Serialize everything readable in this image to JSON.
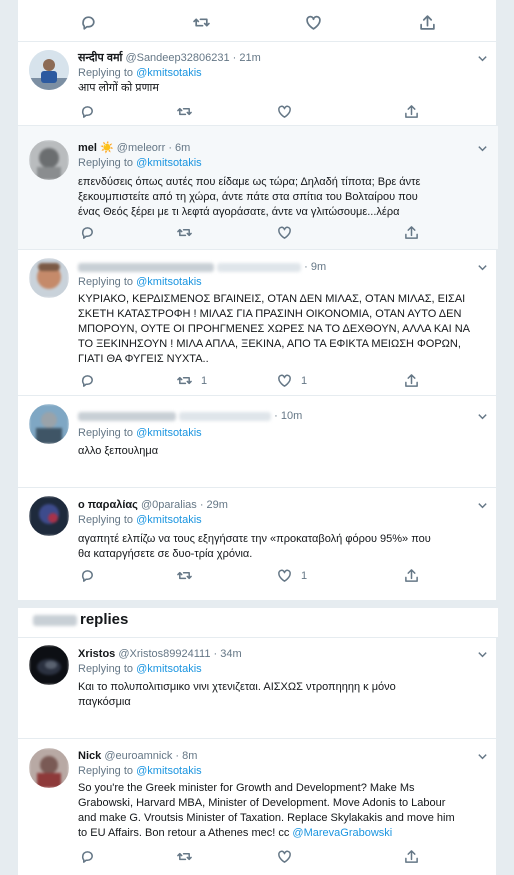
{
  "top_actions": {
    "icons": [
      "reply-icon",
      "retweet-icon",
      "like-icon",
      "share-icon"
    ]
  },
  "tweets": [
    {
      "name": "सन्दीप वर्मा",
      "handle": "@Sandeep32806231",
      "time": "· 21m",
      "replying_prefix": "Replying to",
      "replying_to": "@kmitsotakis",
      "text_lines": [
        "आप लोगों को प्रणाम"
      ],
      "reply_count": "",
      "retweet_count": "",
      "like_count": ""
    },
    {
      "name": "mel",
      "name_emoji": "☀️",
      "handle": "@meleorr",
      "time": "· 6m",
      "replying_prefix": "Replying to",
      "replying_to": "@kmitsotakis",
      "text_lines": [
        "επενδύσεις όπως αυτές που είδαμε ως τώρα; Δηλαδή τίποτα; Βρε άντε",
        "ξεκουμπιστείτε από τη χώρα, άντε πάτε στα σπίτια του Βολταίρου που",
        "ένας Θεός ξέρει με τι λεφτά αγοράσατε, άντε να γλιτώσουμε...λέρα"
      ],
      "reply_count": "",
      "retweet_count": "",
      "like_count": ""
    },
    {
      "name": "",
      "handle": "",
      "time": "· 9m",
      "replying_prefix": "Replying to",
      "replying_to": "@kmitsotakis",
      "text_lines": [
        "ΚΥΡΙΑΚΟ, ΚΕΡΔΙΣΜΕΝΟΣ ΒΓΑΙΝΕΙΣ, ΟΤΑΝ ΔΕΝ ΜΙΛΑΣ, ΟΤΑΝ ΜΙΛΑΣ, ΕΙΣΑΙ",
        "ΣΚΕΤΗ ΚΑΤΑΣΤΡΟΦΗ ! ΜΙΛΑΣ ΓΙΑ ΠΡΑΣΙΝΗ ΟΙΚΟΝΟΜΙΑ, ΟΤΑΝ ΑΥΤΟ ΔΕΝ",
        "ΜΠΟΡΟΥΝ, ΟΥΤΕ ΟΙ ΠΡΟΗΓΜΕΝΕΣ ΧΩΡΕΣ ΝΑ ΤΟ ΔΕΧΘΟΥΝ, ΑΛΛΑ ΚΑΙ ΝΑ",
        "ΤΟ ΞΕΚΙΝΗΣΟΥΝ ! ΜΙΛΑ ΑΠΛΑ, ΞΕΚΙΝΑ, ΑΠΟ ΤΑ ΕΦΙΚΤΑ ΜΕΙΩΣΗ ΦΟΡΩΝ,",
        "ΓΙΑΤΙ ΘΑ ΦΥΓΕΙΣ ΝΥΧΤΑ.."
      ],
      "reply_count": "",
      "retweet_count": "1",
      "like_count": "1"
    },
    {
      "name": "",
      "handle": "",
      "time": "· 10m",
      "replying_prefix": "Replying to",
      "replying_to": "@kmitsotakis",
      "text_lines": [
        "αλλο ξεπουλημα"
      ],
      "reply_count": "",
      "retweet_count": "",
      "like_count": ""
    },
    {
      "name": "ο παραλίας",
      "handle": "@0paralias",
      "time": "· 29m",
      "replying_prefix": "Replying to",
      "replying_to": "@kmitsotakis",
      "text_lines": [
        "αγαπητέ ελπίζω να τους εξηγήσατε την «προκαταβολή φόρου 95%» που",
        "θα καταργήσετε σε δυο-τρία χρόνια."
      ],
      "reply_count": "",
      "retweet_count": "",
      "like_count": "1"
    },
    {
      "name": "Xristos",
      "handle": "@Xristos89924111",
      "time": "· 34m",
      "replying_prefix": "Replying to",
      "replying_to": "@kmitsotakis",
      "text_lines": [
        "Και το πολυπολιτισμικο νινι χτενιζεται. ΑΙΣΧΩΣ ντροπηηηη κ μόνο",
        "παγκόσμια"
      ],
      "reply_count": "",
      "retweet_count": "",
      "like_count": ""
    },
    {
      "name": "Nick",
      "handle": "@euroamnick",
      "time": "· 8m",
      "replying_prefix": "Replying to",
      "replying_to": "@kmitsotakis",
      "text_lines": [
        "So you're the Greek minister for Growth and Development? Make Ms",
        "Grabowski, Harvard MBA, Minister of Development. Move Adonis to Labour",
        "and make G. Vroutsis Minister of Taxation. Replace Skylakakis and move him",
        "to EU Affairs. Bon retour a Athenes mec! cc"
      ],
      "text_link": "@MarevaGrabowski",
      "reply_count": "",
      "retweet_count": "",
      "like_count": ""
    }
  ],
  "more_replies": {
    "label": "replies"
  },
  "colors": {
    "link": "#1b95e0",
    "secondary": "#657786",
    "divider": "#e6ecf0",
    "page_bg": "#e6ecf0"
  }
}
